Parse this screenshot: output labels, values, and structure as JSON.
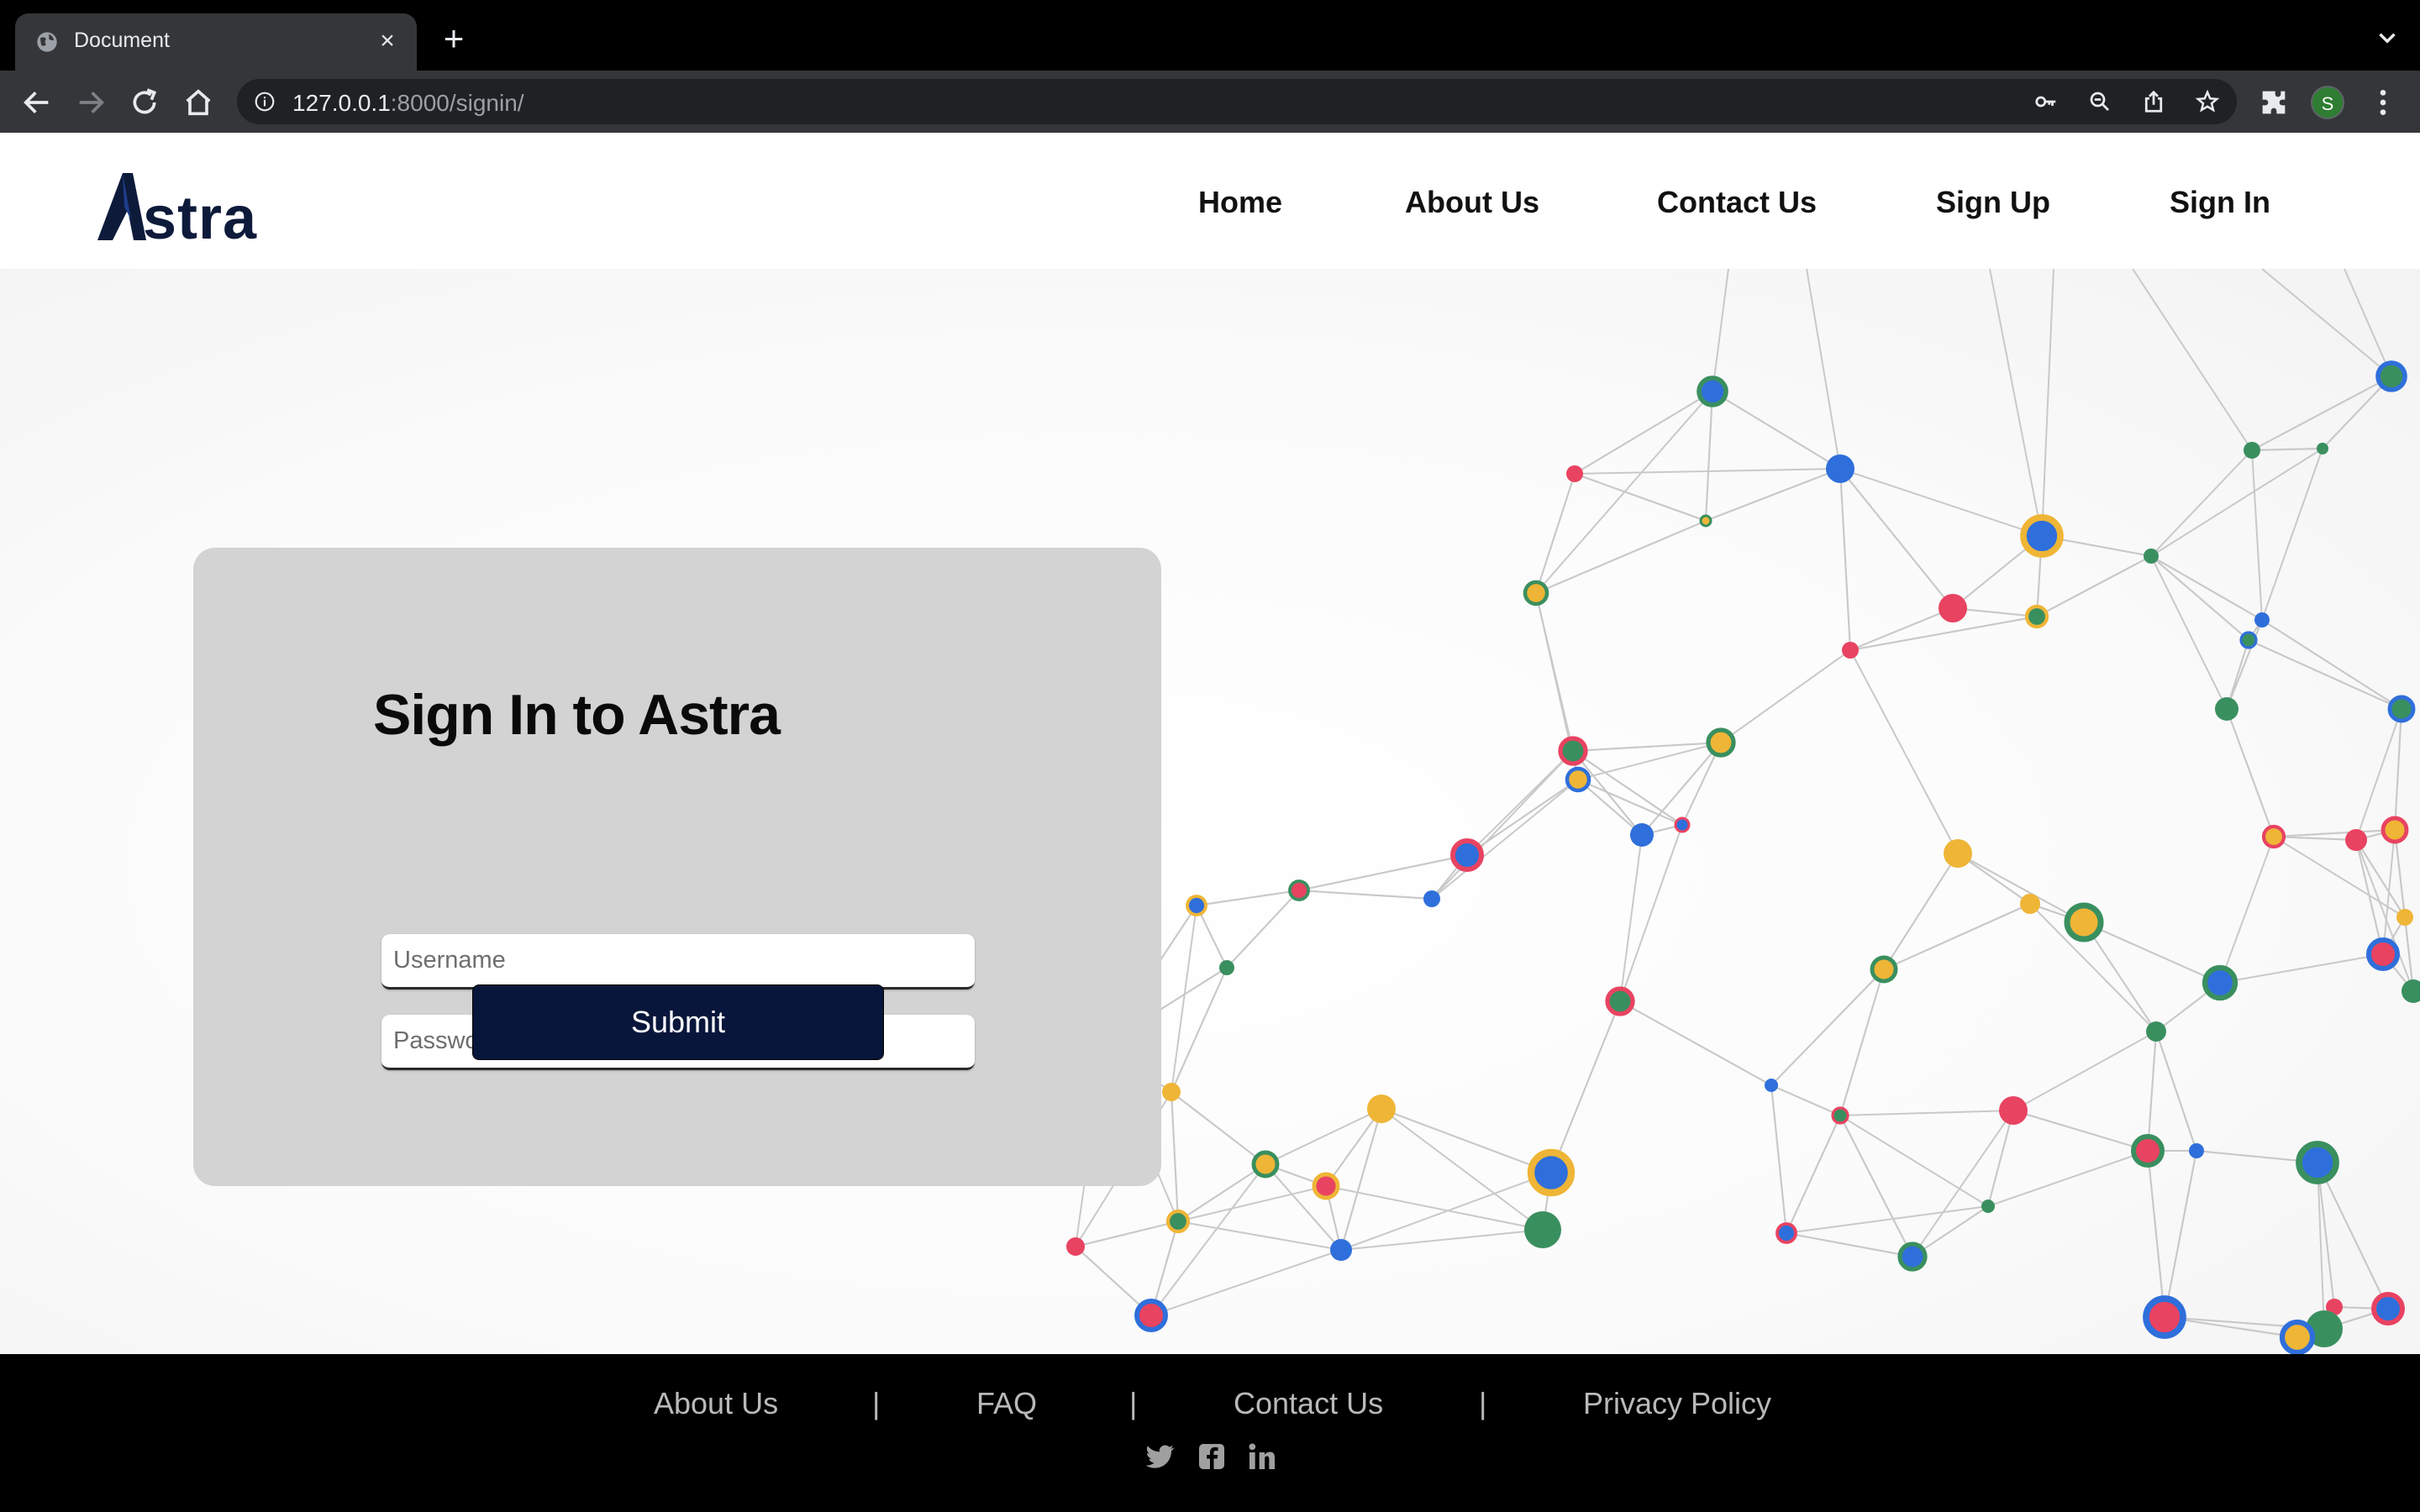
{
  "browser": {
    "tab_title": "Document",
    "url_host": "127.0.0.1",
    "url_rest": ":8000/signin/",
    "profile_initial": "S"
  },
  "navbar": {
    "logo_text": "Astra",
    "links": [
      "Home",
      "About Us",
      "Contact Us",
      "Sign Up",
      "Sign In"
    ]
  },
  "signin": {
    "title": "Sign In to Astra",
    "username_placeholder": "Username",
    "password_placeholder": "Password",
    "submit_label": "Submit"
  },
  "footer": {
    "links": [
      "About Us",
      "FAQ",
      "Contact Us",
      "Privacy Policy"
    ],
    "separator": "|",
    "social_icons": [
      "twitter-icon",
      "facebook-icon",
      "linkedin-icon"
    ]
  },
  "colors": {
    "brand_navy": "#09163b",
    "card_gray": "#d3d3d3",
    "node_blue": "#2f6fdb",
    "node_green": "#3a8f5f",
    "node_red": "#e84361",
    "node_yellow": "#efb536"
  }
}
